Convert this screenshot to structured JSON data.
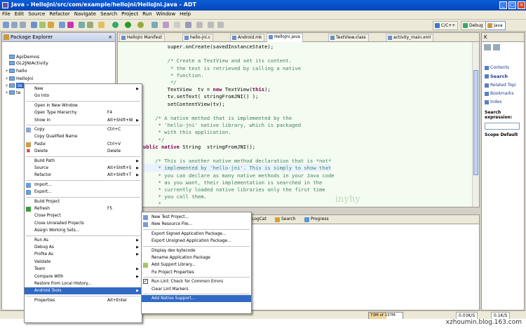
{
  "window": {
    "title": "Java - HelloJni/src/com/example/hellojni/HelloJni.java - ADT"
  },
  "menubar": [
    "File",
    "Edit",
    "Source",
    "Refactor",
    "Navigate",
    "Search",
    "Project",
    "Run",
    "Window",
    "Help"
  ],
  "perspectives": [
    "C/C++",
    "Debug",
    "Java"
  ],
  "package_explorer": {
    "title": "Package Explorer",
    "items": [
      {
        "label": "ApiDemos",
        "expander": ""
      },
      {
        "label": "GL2JNIActivity",
        "expander": ""
      },
      {
        "label": "hello",
        "expander": "+"
      },
      {
        "label": "HelloJni",
        "expander": "+"
      },
      {
        "label": "te",
        "expander": "+"
      },
      {
        "label": "te",
        "expander": "+"
      }
    ]
  },
  "editor": {
    "tabs": [
      "HelloJni Manifest",
      "hello-jni.c",
      "Android.mk",
      "HelloJni.java",
      "TextView.class",
      "activity_main.xml"
    ],
    "lines": [
      "        super.onCreate(savedInstanceState);",
      "",
      "        /* Create a TextView and set its content.",
      "         * the text is retrieved by calling a native",
      "         * function.",
      "         */",
      "        TextView  tv = new TextView(this);",
      "        tv.setText( stringFromJNI() );",
      "        setContentView(tv);",
      "",
      "    /* A native method that is implemented by the",
      "     * 'hello-jni' native library, which is packaged",
      "     * with this application.",
      "     */",
      "ublic native String  stringFromJNI();",
      "",
      "    /* This is another native method declaration that is *not*",
      "     * implemented by 'hello-jni'. This is simply to show that",
      "     * you can declare as many native methods in your Java code",
      "     * as you want, their implementation is searched in the",
      "     * currently loaded native libraries only the first time",
      "     * you call them.",
      "     *"
    ],
    "watermark": "inyhy"
  },
  "bottom_tabs": [
    "LogCat",
    "Search",
    "Progress"
  ],
  "right_panel": {
    "items": [
      "Contents",
      "Search",
      "Related Topi",
      "Bookmarks",
      "Index"
    ],
    "search_label": "Search expression:",
    "scope_label": "Scope Default"
  },
  "status": {
    "heap": "73M of 137M",
    "heap_fraction": 0.53,
    "net_down": "0.03K/S",
    "net_up": "0.1K/S"
  },
  "taskbar_text": "xzhoumin.blog.163.com",
  "context_menu": {
    "items": [
      {
        "label": "New",
        "sub": true
      },
      {
        "label": "Go Into"
      },
      {
        "sep": true
      },
      {
        "label": "Open in New Window"
      },
      {
        "label": "Open Type Hierarchy",
        "acc": "F4"
      },
      {
        "label": "Show In",
        "acc": "Alt+Shift+W",
        "sub": true
      },
      {
        "sep": true
      },
      {
        "label": "Copy",
        "acc": "Ctrl+C",
        "icon": "copy"
      },
      {
        "label": "Copy Qualified Name"
      },
      {
        "label": "Paste",
        "acc": "Ctrl+V",
        "icon": "paste"
      },
      {
        "label": "Delete",
        "acc": "Delete",
        "icon": "delete"
      },
      {
        "sep": true
      },
      {
        "label": "Build Path",
        "sub": true
      },
      {
        "label": "Source",
        "acc": "Alt+Shift+S",
        "sub": true
      },
      {
        "label": "Refactor",
        "acc": "Alt+Shift+T",
        "sub": true
      },
      {
        "sep": true
      },
      {
        "label": "Import...",
        "icon": "import"
      },
      {
        "label": "Export...",
        "icon": "export"
      },
      {
        "sep": true
      },
      {
        "label": "Build Project"
      },
      {
        "label": "Refresh",
        "acc": "F5",
        "icon": "refresh"
      },
      {
        "label": "Close Project"
      },
      {
        "label": "Close Unrelated Projects"
      },
      {
        "label": "Assign Working Sets..."
      },
      {
        "sep": true
      },
      {
        "label": "Run As",
        "sub": true
      },
      {
        "label": "Debug As",
        "sub": true
      },
      {
        "label": "Profile As",
        "sub": true
      },
      {
        "label": "Validate"
      },
      {
        "label": "Team",
        "sub": true
      },
      {
        "label": "Compare With",
        "sub": true
      },
      {
        "label": "Restore from Local History..."
      },
      {
        "label": "Android Tools",
        "sub": true,
        "hi": true
      },
      {
        "sep": true
      },
      {
        "label": "Properties",
        "acc": "Alt+Enter"
      }
    ]
  },
  "android_tools_menu": {
    "items": [
      {
        "label": "New Test Project...",
        "icon": "new"
      },
      {
        "label": "New Resource File...",
        "icon": "new"
      },
      {
        "sep": true
      },
      {
        "label": "Export Signed Application Package..."
      },
      {
        "label": "Export Unsigned Application Package..."
      },
      {
        "sep": true
      },
      {
        "label": "Display dex bytecode"
      },
      {
        "label": "Rename Application Package"
      },
      {
        "label": "Add Support Library...",
        "icon": "support"
      },
      {
        "label": "Fix Project Properties"
      },
      {
        "sep": true
      },
      {
        "label": "Run Lint: Check for Common Errors",
        "check": true
      },
      {
        "label": "Clear Lint Markers"
      },
      {
        "sep": true
      },
      {
        "label": "Add Native Support...",
        "hi": true
      }
    ]
  }
}
